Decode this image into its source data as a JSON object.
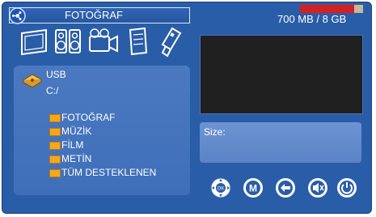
{
  "header": {
    "title": "FOTOĞRAF"
  },
  "storage": {
    "text": "700 MB / 8 GB",
    "used_fraction": 0.86,
    "fill_color": "#d62020",
    "track_color": "#c7b89e"
  },
  "media_tabs": [
    "photo-icon",
    "music-icon",
    "video-icon",
    "document-icon",
    "usb-icon"
  ],
  "browser": {
    "device": "USB",
    "path": "C:/",
    "folders": [
      "FOTOĞRAF",
      "MÜZİK",
      "FİLM",
      "METİN",
      "TÜM DESTEKLENEN"
    ]
  },
  "info": {
    "size_label": "Size:"
  },
  "controls": {
    "ok_label": "OK",
    "menu_label": "M",
    "icons": [
      "ok-dpad-icon",
      "menu-icon",
      "back-icon",
      "mute-icon",
      "power-icon"
    ]
  },
  "colors": {
    "background": "#2a5da8",
    "text": "#ffffff",
    "folder": "#f4a81b"
  }
}
